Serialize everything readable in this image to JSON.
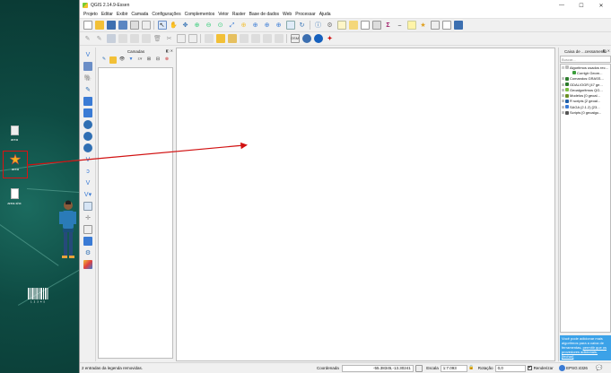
{
  "window": {
    "title": "QGIS 2.14.9-Essen",
    "minimize": "—",
    "maximize": "☐",
    "close": "✕"
  },
  "menus": [
    "Projeto",
    "Editar",
    "Exibir",
    "Camada",
    "Configurações",
    "Complementos",
    "Vetor",
    "Raster",
    "Base de dados",
    "Web",
    "Processar",
    "Ajuda"
  ],
  "desktop": {
    "icons": [
      {
        "name": "doc-icon",
        "label": "area"
      },
      {
        "name": "spark-icon",
        "label": "area"
      },
      {
        "name": "file-icon",
        "label": "area.shx"
      }
    ]
  },
  "layers_panel": {
    "title": "Camadas"
  },
  "processing_panel": {
    "title": "Caixa de ...cessamento",
    "search_placeholder": "Buscar...",
    "tree": [
      {
        "label": "Algoritmos usados rec...",
        "color": "#bbbbbb",
        "exp": "⊟"
      },
      {
        "label": "Corrigir Geom...",
        "color": "#3c9d3c",
        "exp": "",
        "indent": true
      },
      {
        "label": "Comandos GRASS...",
        "color": "#2f7f2f",
        "exp": "⊞"
      },
      {
        "label": "GDAL/OGR [47 ge...",
        "color": "#2b7a2b",
        "exp": "⊞"
      },
      {
        "label": "Geoalgoritmos QG...",
        "color": "#7bc043",
        "exp": "⊞"
      },
      {
        "label": "Modelos [0 geoal...",
        "color": "#6b8e23",
        "exp": "⊞"
      },
      {
        "label": "R scripts [2 geoal...",
        "color": "#1f5fa8",
        "exp": "⊞"
      },
      {
        "label": "SAGA (2.1.2) [23...",
        "color": "#3a7bd5",
        "exp": "⊞"
      },
      {
        "label": "Scripts [0 geoalgo...",
        "color": "#555555",
        "exp": "⊞"
      }
    ],
    "tip_text": "Você pode adicionar mais algoritmos para a caixa de ferramentas,",
    "tip_link1": "permitir que os provedores adicionais.",
    "tip_link2": "[fechar]"
  },
  "status": {
    "message": "2 entradas da legenda removidas.",
    "coord_label": "Coordenada",
    "coord_value": "-55.38345,-13.30241",
    "scale_label": "Escala",
    "scale_value": "1:7.093",
    "rotation_label": "Rotação",
    "rotation_value": "0,0",
    "render_label": "Renderizar",
    "crs": "EPSG:4326"
  },
  "colors": {
    "annotation": "#d11111",
    "tip_bg": "#3ca2e8",
    "desktop": "#0f4f47"
  }
}
